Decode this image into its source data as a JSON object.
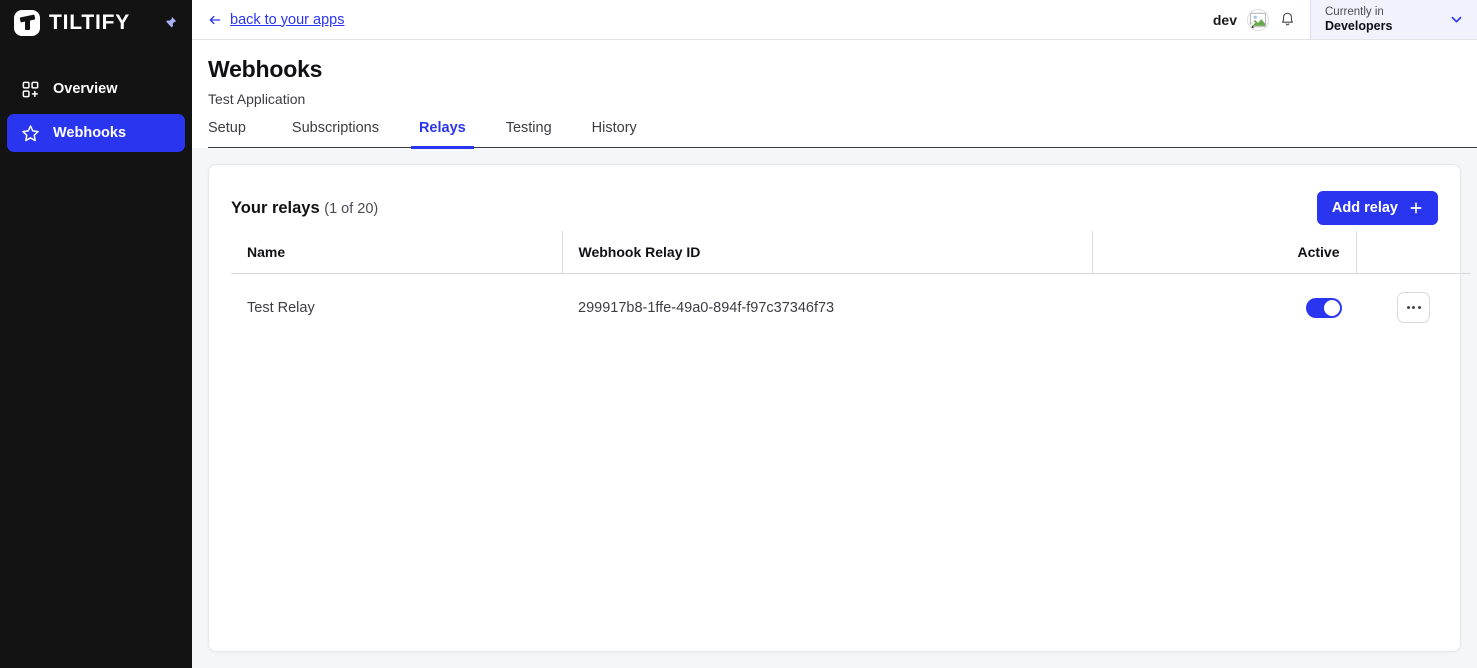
{
  "sidebar": {
    "brand": {
      "name": "TILTIFY",
      "logo_icon": "tiltify-logo-icon",
      "pin_icon": "pin-icon"
    },
    "items": [
      {
        "label": "Overview",
        "icon": "dashboard-grid-add-icon",
        "active": false
      },
      {
        "label": "Webhooks",
        "icon": "star-icon",
        "active": true
      }
    ]
  },
  "topbar": {
    "back_link": "back to your apps",
    "back_icon": "arrow-left-icon",
    "user_name": "dev",
    "avatar_icon": "broken-image-avatar-icon",
    "bell_icon": "notification-bell-icon",
    "org": {
      "label": "Currently in",
      "value": "Developers",
      "chevron_icon": "chevron-down-icon"
    }
  },
  "page": {
    "title": "Webhooks",
    "subtitle": "Test Application",
    "tabs": [
      {
        "label": "Setup",
        "active": false
      },
      {
        "label": "Subscriptions",
        "active": false
      },
      {
        "label": "Relays",
        "active": true
      },
      {
        "label": "Testing",
        "active": false
      },
      {
        "label": "History",
        "active": false
      }
    ]
  },
  "card": {
    "title": "Your relays",
    "count": "(1 of 20)",
    "add_button": {
      "label": "Add relay",
      "icon": "plus-icon"
    },
    "table": {
      "columns": [
        "Name",
        "Webhook Relay ID",
        "Active",
        ""
      ],
      "rows": [
        {
          "name": "Test Relay",
          "relay_id": "299917b8-1ffe-49a0-894f-f97c37346f73",
          "active": true,
          "menu_icon": "kebab-menu-icon"
        }
      ]
    }
  },
  "colors": {
    "accent": "#2a35f0",
    "sidebar_bg": "#131313",
    "page_bg": "#f5f6f7",
    "org_bg": "#f1f2fc"
  }
}
